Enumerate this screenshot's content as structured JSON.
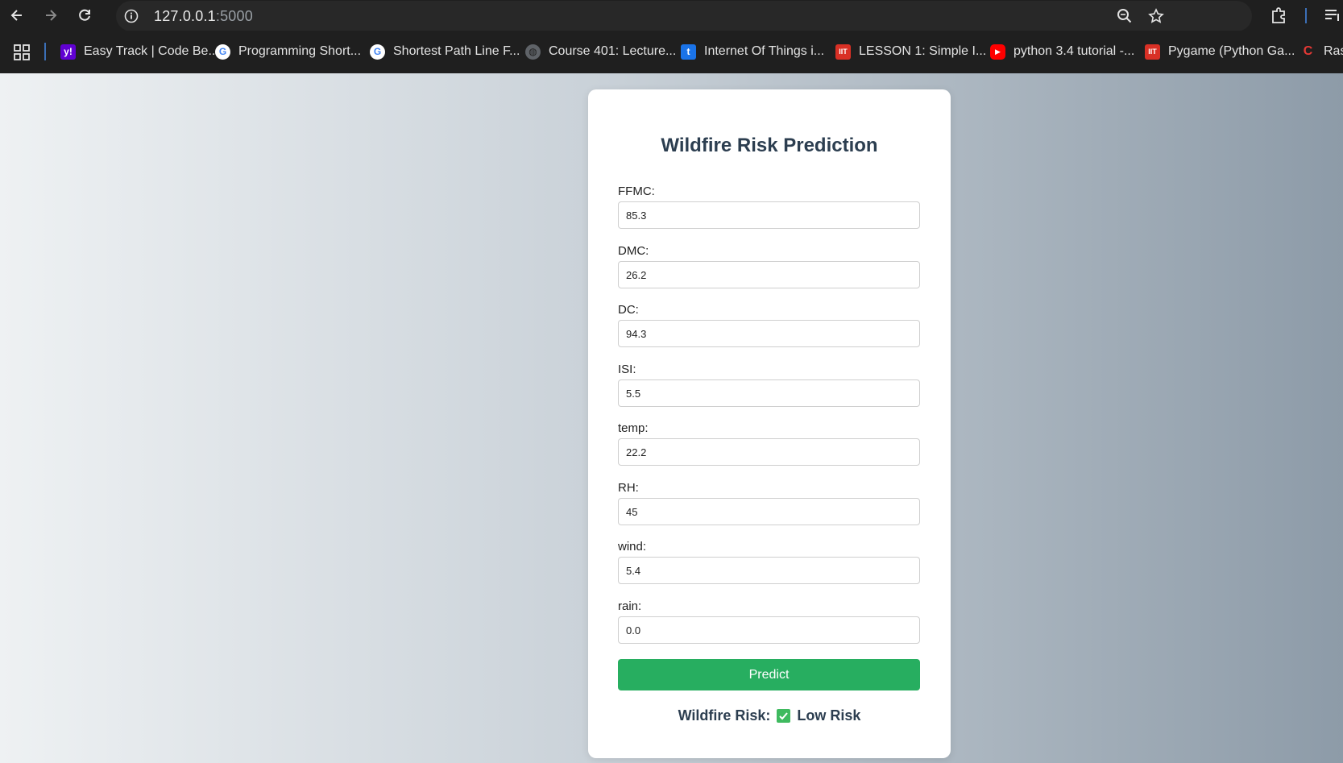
{
  "browser": {
    "url_host": "127.0.0.1",
    "url_port": ":5000",
    "bookmarks": [
      {
        "label": "Easy Track | Code Be...",
        "icon": "yahoo-icon"
      },
      {
        "label": "Programming Short...",
        "icon": "google-icon"
      },
      {
        "label": "Shortest Path Line F...",
        "icon": "google-icon"
      },
      {
        "label": "Course 401: Lecture...",
        "icon": "globe-icon"
      },
      {
        "label": "Internet Of Things i...",
        "icon": "t-icon"
      },
      {
        "label": "LESSON 1: Simple I...",
        "icon": "iit-icon"
      },
      {
        "label": "python 3.4 tutorial -...",
        "icon": "youtube-icon"
      },
      {
        "label": "Pygame (Python Ga...",
        "icon": "iit-icon"
      },
      {
        "label": "Ras",
        "icon": "red-c-icon"
      }
    ]
  },
  "page": {
    "title": "Wildfire Risk Prediction",
    "fields": [
      {
        "label": "FFMC:",
        "value": "85.3"
      },
      {
        "label": "DMC:",
        "value": "26.2"
      },
      {
        "label": "DC:",
        "value": "94.3"
      },
      {
        "label": "ISI:",
        "value": "5.5"
      },
      {
        "label": "temp:",
        "value": "22.2"
      },
      {
        "label": "RH:",
        "value": "45"
      },
      {
        "label": "wind:",
        "value": "5.4"
      },
      {
        "label": "rain:",
        "value": "0.0"
      }
    ],
    "predict_label": "Predict",
    "result_label": "Wildfire Risk:",
    "result_value": "Low Risk",
    "colors": {
      "title": "#2c3e50",
      "button": "#27ae60",
      "check": "#3fba5f"
    }
  }
}
